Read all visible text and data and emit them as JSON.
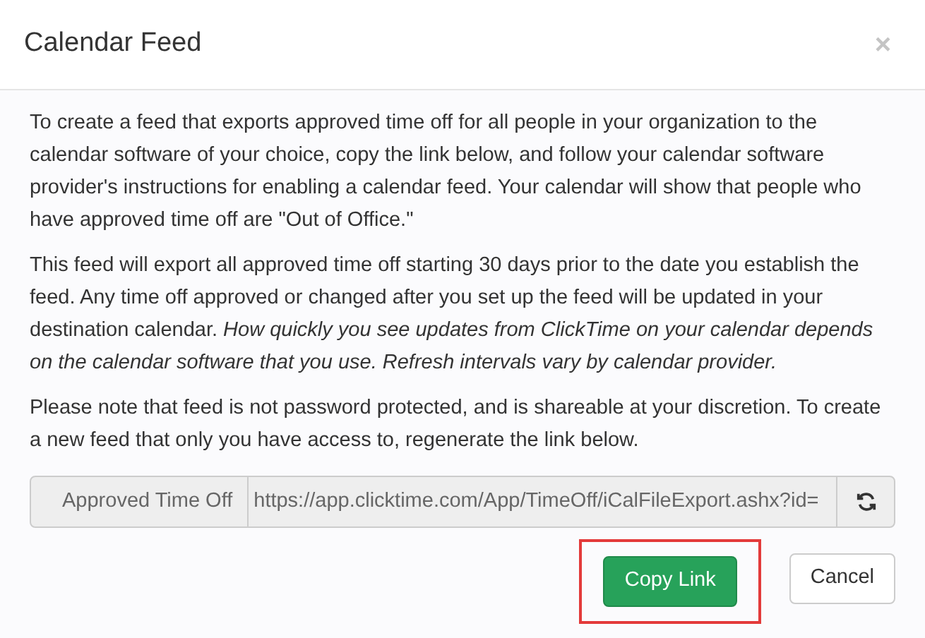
{
  "dialog": {
    "title": "Calendar Feed",
    "close_icon": "×"
  },
  "paragraphs": [
    "To create a feed that exports approved time off for all people in your organization to the calendar software of your choice, copy the link below, and follow your calendar software provider's instructions for enabling a calendar feed. Your calendar will show that people who have approved time off are \"Out of Office.\"",
    "This feed will export all approved time off starting 30 days prior to the date you establish the feed. Any time off approved or changed after you set up the feed will be updated in your destination calendar. *How quickly you see updates from ClickTime on your calendar depends on the calendar software that you use. Refresh intervals vary by calendar provider.*",
    "Please note that feed is not password protected, and is shareable at your discretion. To create a new feed that only you have access to, regenerate the link below."
  ],
  "link_field": {
    "label": "Approved Time Off",
    "value": "https://app.clicktime.com/App/TimeOff/iCalFileExport.ashx?id="
  },
  "buttons": [
    {
      "label": "Copy Link",
      "kind": "primary",
      "highlighted": true
    },
    {
      "label": "Cancel",
      "kind": "default",
      "highlighted": false
    }
  ]
}
